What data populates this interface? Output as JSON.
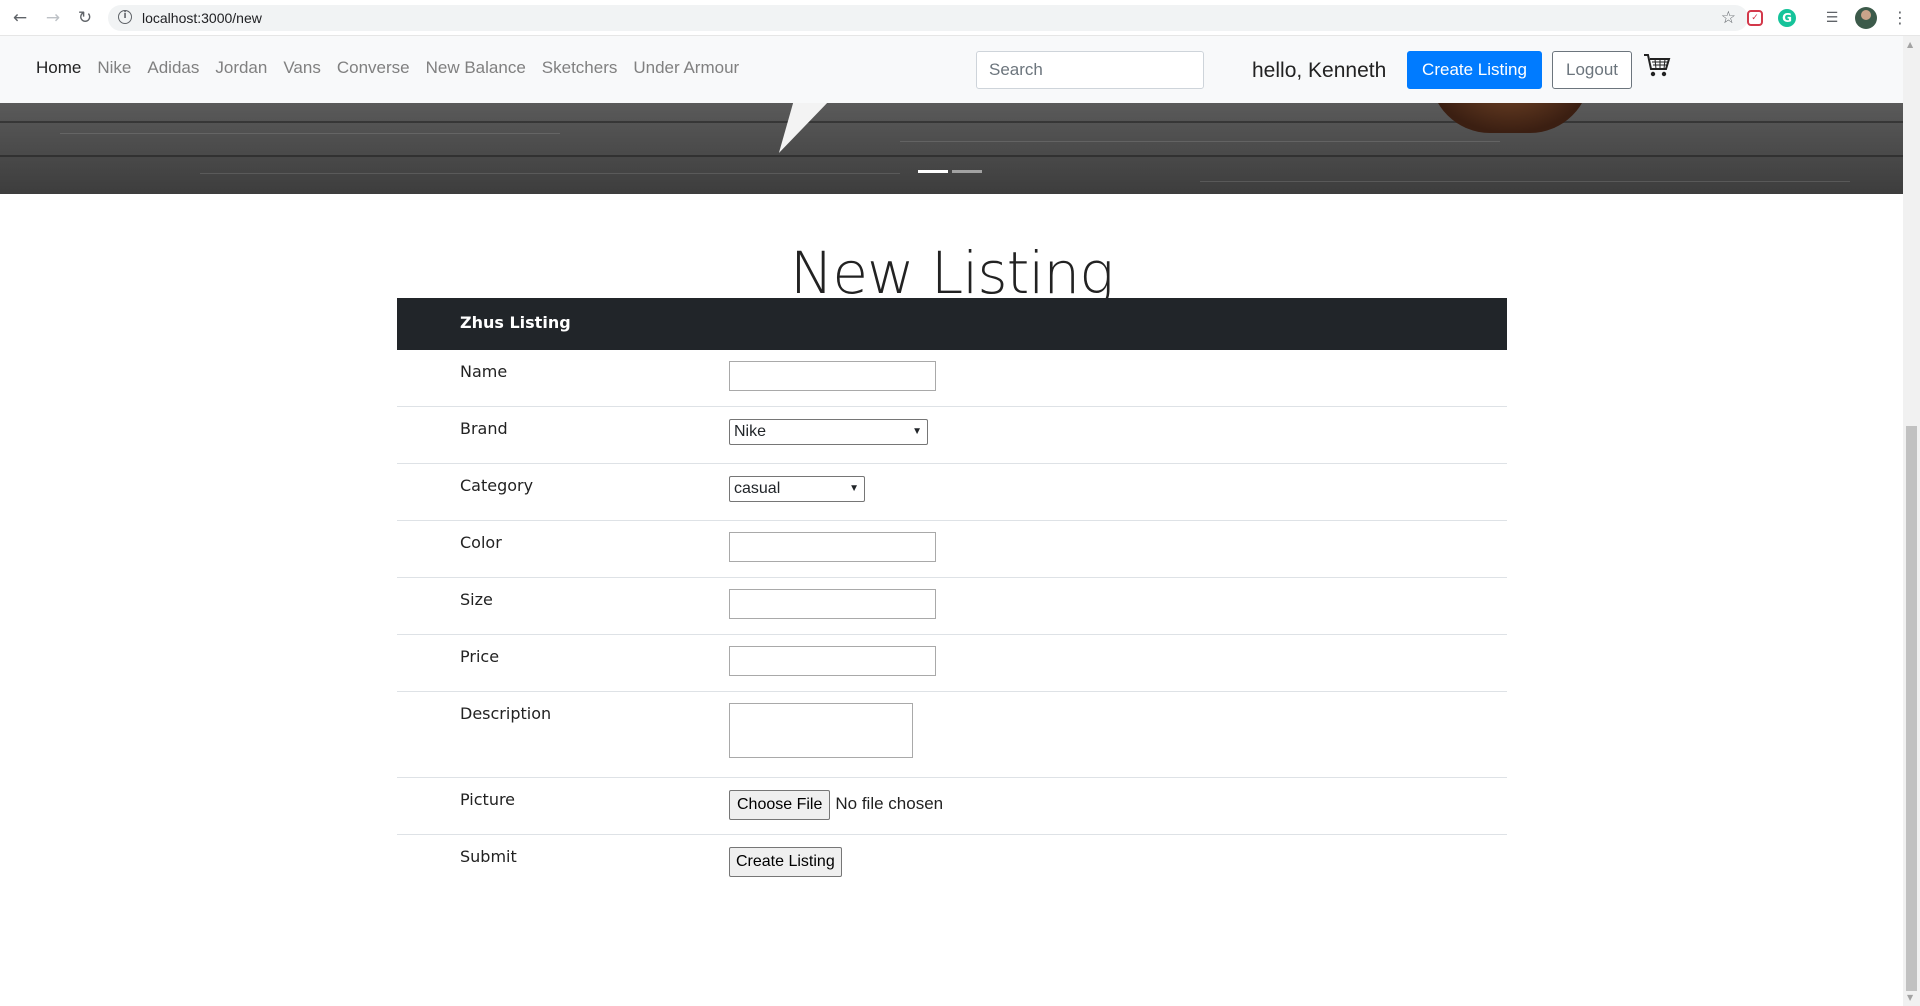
{
  "browser": {
    "url": "localhost:3000/new"
  },
  "navbar": {
    "links": [
      {
        "label": "Home",
        "active": true
      },
      {
        "label": "Nike"
      },
      {
        "label": "Adidas"
      },
      {
        "label": "Jordan"
      },
      {
        "label": "Vans"
      },
      {
        "label": "Converse"
      },
      {
        "label": "New Balance"
      },
      {
        "label": "Sketchers"
      },
      {
        "label": "Under Armour"
      }
    ],
    "search_placeholder": "Search",
    "greeting": "hello, Kenneth",
    "create_label": "Create Listing",
    "logout_label": "Logout",
    "accent_color": "#007bff"
  },
  "carousel": {
    "slides": 2,
    "active_slide": 1
  },
  "page": {
    "title": "New Listing"
  },
  "form": {
    "header": "Zhus Listing",
    "header_color": "#212529",
    "fields": {
      "name": {
        "label": "Name",
        "value": ""
      },
      "brand": {
        "label": "Brand",
        "value": "Nike"
      },
      "category": {
        "label": "Category",
        "value": "casual"
      },
      "color": {
        "label": "Color",
        "value": ""
      },
      "size": {
        "label": "Size",
        "value": ""
      },
      "price": {
        "label": "Price",
        "value": ""
      },
      "description": {
        "label": "Description",
        "value": ""
      },
      "picture": {
        "label": "Picture",
        "button": "Choose File",
        "status": "No file chosen"
      },
      "submit": {
        "label": "Submit",
        "button": "Create Listing"
      }
    }
  }
}
